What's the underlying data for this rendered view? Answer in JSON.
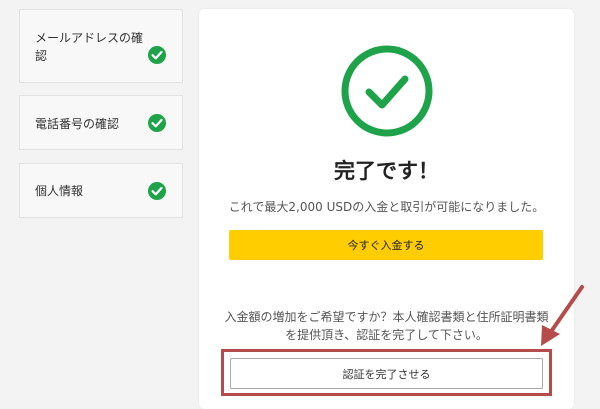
{
  "sidebar": {
    "steps": [
      {
        "label": "メールアドレスの確認",
        "status": "complete"
      },
      {
        "label": "電話番号の確認",
        "status": "complete"
      },
      {
        "label": "個人情報",
        "status": "complete"
      }
    ]
  },
  "main": {
    "title": "完了です！",
    "description": "これで最大2,000 USDの入金と取引が可能になりました。",
    "deposit_button_label": "今すぐ入金する",
    "info_text": "入金額の増加をご希望ですか？本人確認書類と住所証明書類を提供頂き、認証を完了して下さい。",
    "complete_button_label": "認証を完了させる"
  },
  "colors": {
    "success_green": "#1fa34a",
    "accent_yellow": "#ffcd00",
    "annotation_red": "#b54b4b"
  }
}
